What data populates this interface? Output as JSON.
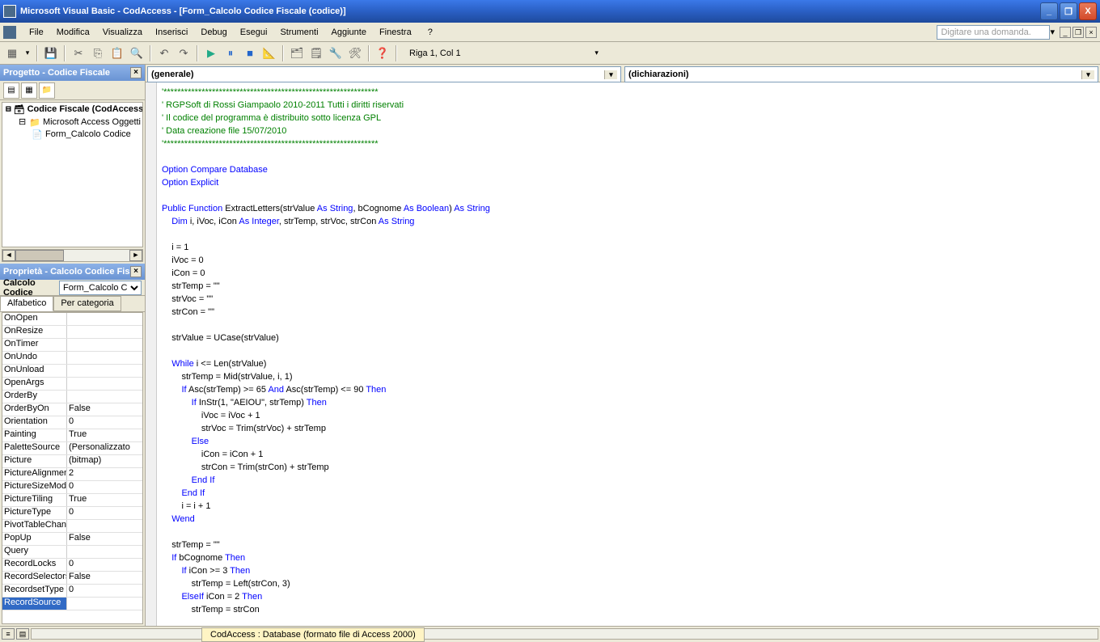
{
  "title": "Microsoft Visual Basic - CodAccess - [Form_Calcolo Codice Fiscale (codice)]",
  "menu": {
    "file": "File",
    "modifica": "Modifica",
    "visualizza": "Visualizza",
    "inserisci": "Inserisci",
    "debug": "Debug",
    "esegui": "Esegui",
    "strumenti": "Strumenti",
    "aggiunte": "Aggiunte",
    "finestra": "Finestra",
    "help": "?"
  },
  "searchPlaceholder": "Digitare una domanda.",
  "cursorStatus": "Riga 1, Col 1",
  "projectPanel": {
    "title": "Progetto - Codice Fiscale",
    "tree": {
      "root": "Codice Fiscale (CodAccess",
      "folder": "Microsoft Access Oggetti",
      "item": "Form_Calcolo Codice"
    }
  },
  "propsPanel": {
    "title": "Proprietà - Calcolo Codice Fis",
    "objLabel": "Calcolo Codice",
    "objSel": "Form_Calcolo C",
    "tabs": {
      "alpha": "Alfabetico",
      "cat": "Per categoria"
    },
    "rows": [
      {
        "n": "OnOpen",
        "v": ""
      },
      {
        "n": "OnResize",
        "v": ""
      },
      {
        "n": "OnTimer",
        "v": ""
      },
      {
        "n": "OnUndo",
        "v": ""
      },
      {
        "n": "OnUnload",
        "v": ""
      },
      {
        "n": "OpenArgs",
        "v": ""
      },
      {
        "n": "OrderBy",
        "v": ""
      },
      {
        "n": "OrderByOn",
        "v": "False"
      },
      {
        "n": "Orientation",
        "v": "0"
      },
      {
        "n": "Painting",
        "v": "True"
      },
      {
        "n": "PaletteSource",
        "v": "(Personalizzato"
      },
      {
        "n": "Picture",
        "v": "(bitmap)"
      },
      {
        "n": "PictureAlignment",
        "v": "2"
      },
      {
        "n": "PictureSizeMode",
        "v": "0"
      },
      {
        "n": "PictureTiling",
        "v": "True"
      },
      {
        "n": "PictureType",
        "v": "0"
      },
      {
        "n": "PivotTableChange",
        "v": ""
      },
      {
        "n": "PopUp",
        "v": "False"
      },
      {
        "n": "Query",
        "v": ""
      },
      {
        "n": "RecordLocks",
        "v": "0"
      },
      {
        "n": "RecordSelectors",
        "v": "False"
      },
      {
        "n": "RecordsetType",
        "v": "0"
      },
      {
        "n": "RecordSource",
        "v": ""
      }
    ]
  },
  "combos": {
    "left": "(generale)",
    "right": "(dichiarazioni)"
  },
  "code": {
    "l1": "'**************************************************************",
    "l2": "' RGPSoft di Rossi Giampaolo 2010-2011 Tutti i diritti riservati",
    "l3": "' Il codice del programma è distribuito sotto licenza GPL",
    "l4": "' Data creazione file 15/07/2010",
    "l5": "'**************************************************************",
    "l6": "Option Compare Database",
    "l7": "Option Explicit",
    "l8a": "Public Function",
    "l8b": " ExtractLetters(strValue ",
    "l8c": "As String",
    "l8d": ", bCognome ",
    "l8e": "As Boolean",
    "l8f": ") ",
    "l8g": "As String",
    "l9a": "    Dim",
    "l9b": " i, iVoc, iCon ",
    "l9c": "As Integer",
    "l9d": ", strTemp, strVoc, strCon ",
    "l9e": "As String",
    "l10": "    i = 1",
    "l11": "    iVoc = 0",
    "l12": "    iCon = 0",
    "l13": "    strTemp = \"\"",
    "l14": "    strVoc = \"\"",
    "l15": "    strCon = \"\"",
    "l16": "    strValue = UCase(strValue)",
    "l17a": "    While",
    "l17b": " i <= Len(strValue)",
    "l18": "        strTemp = Mid(strValue, i, 1)",
    "l19a": "        If",
    "l19b": " Asc(strTemp) >= 65 ",
    "l19c": "And",
    "l19d": " Asc(strTemp) <= 90 ",
    "l19e": "Then",
    "l20a": "            If",
    "l20b": " InStr(1, \"AEIOU\", strTemp) ",
    "l20c": "Then",
    "l21": "                iVoc = iVoc + 1",
    "l22": "                strVoc = Trim(strVoc) + strTemp",
    "l23": "            Else",
    "l24": "                iCon = iCon + 1",
    "l25": "                strCon = Trim(strCon) + strTemp",
    "l26": "            End If",
    "l27": "        End If",
    "l28": "        i = i + 1",
    "l29": "    Wend",
    "l30": "    strTemp = \"\"",
    "l31a": "    If",
    "l31b": " bCognome ",
    "l31c": "Then",
    "l32a": "        If",
    "l32b": " iCon >= 3 ",
    "l32c": "Then",
    "l33": "            strTemp = Left(strCon, 3)",
    "l34a": "        ElseIf",
    "l34b": " iCon = 2 ",
    "l34c": "Then",
    "l35": "            strTemp = strCon"
  },
  "bottomTab": "CodAccess : Database (formato file di Access 2000)"
}
